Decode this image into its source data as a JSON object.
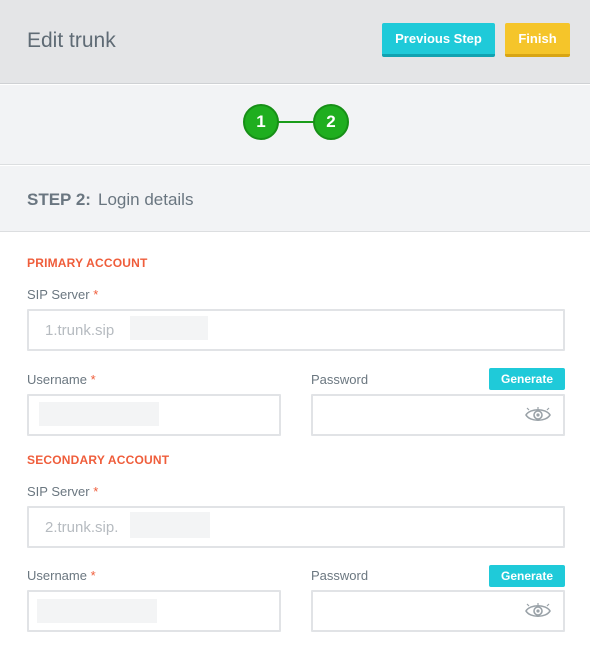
{
  "header": {
    "title": "Edit trunk",
    "previous_label": "Previous Step",
    "finish_label": "Finish"
  },
  "stepper": {
    "steps": [
      "1",
      "2"
    ]
  },
  "step_heading": {
    "number": "STEP 2:",
    "name": "Login details"
  },
  "primary": {
    "section_title": "PRIMARY ACCOUNT",
    "sip_label": "SIP Server",
    "sip_value": "1.trunk.sip",
    "username_label": "Username",
    "password_label": "Password",
    "generate_label": "Generate"
  },
  "secondary": {
    "section_title": "SECONDARY ACCOUNT",
    "sip_label": "SIP Server",
    "sip_value": "2.trunk.sip.",
    "username_label": "Username",
    "password_label": "Password",
    "generate_label": "Generate"
  },
  "required_marker": "*",
  "colors": {
    "accent_cyan": "#1fcad9",
    "accent_yellow": "#f5c52a",
    "step_green": "#1fae1f",
    "section_red": "#ef5d3b"
  }
}
